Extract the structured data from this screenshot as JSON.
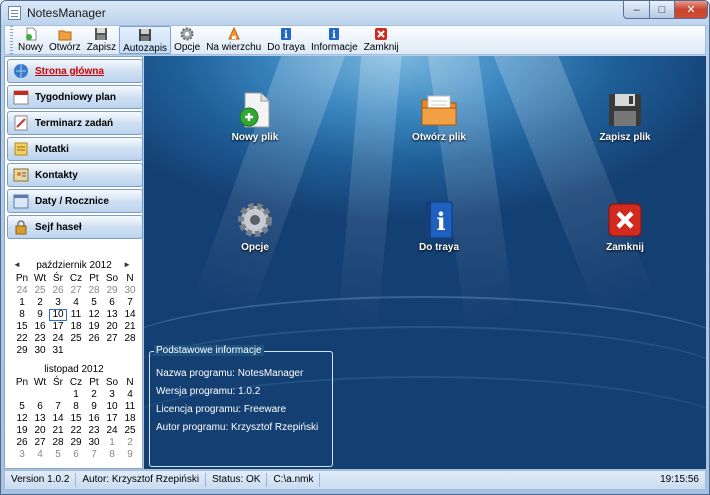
{
  "window": {
    "title": "NotesManager",
    "min_glyph": "–",
    "max_glyph": "□",
    "close_glyph": "✕"
  },
  "toolbar": {
    "items": [
      {
        "label": "Nowy",
        "icon": "new-file-icon"
      },
      {
        "label": "Otwórz",
        "icon": "open-folder-icon"
      },
      {
        "label": "Zapisz",
        "icon": "save-icon"
      },
      {
        "label": "Autozapis",
        "icon": "autosave-icon"
      },
      {
        "label": "Opcje",
        "icon": "gear-icon"
      },
      {
        "label": "Na wierzchu",
        "icon": "on-top-icon"
      },
      {
        "label": "Do traya",
        "icon": "info-icon"
      },
      {
        "label": "Informacje",
        "icon": "info-icon"
      },
      {
        "label": "Zamknij",
        "icon": "close-icon"
      }
    ]
  },
  "sidebar": {
    "items": [
      {
        "label": "Strona główna",
        "icon": "home-icon"
      },
      {
        "label": "Tygodniowy plan",
        "icon": "calendar-icon"
      },
      {
        "label": "Terminarz zadań",
        "icon": "notepad-icon"
      },
      {
        "label": "Notatki",
        "icon": "notes-icon"
      },
      {
        "label": "Kontakty",
        "icon": "contacts-icon"
      },
      {
        "label": "Daty / Rocznice",
        "icon": "dates-icon"
      },
      {
        "label": "Sejf haseł",
        "icon": "safe-icon"
      }
    ]
  },
  "calendar": {
    "prev": "◄",
    "next": "►",
    "day_headers": [
      "Pn",
      "Wt",
      "Śr",
      "Cz",
      "Pt",
      "So",
      "N"
    ],
    "month1": {
      "title": "październik 2012",
      "days": [
        [
          "24",
          "25",
          "26",
          "27",
          "28",
          "29",
          "30"
        ],
        [
          "1",
          "2",
          "3",
          "4",
          "5",
          "6",
          "7"
        ],
        [
          "8",
          "9",
          "10",
          "11",
          "12",
          "13",
          "14"
        ],
        [
          "15",
          "16",
          "17",
          "18",
          "19",
          "20",
          "21"
        ],
        [
          "22",
          "23",
          "24",
          "25",
          "26",
          "27",
          "28"
        ],
        [
          "29",
          "30",
          "31",
          "",
          "",
          "",
          ""
        ]
      ],
      "today": "10"
    },
    "month2": {
      "title": "listopad 2012",
      "days": [
        [
          "",
          "",
          "",
          "1",
          "2",
          "3",
          "4"
        ],
        [
          "5",
          "6",
          "7",
          "8",
          "9",
          "10",
          "11"
        ],
        [
          "12",
          "13",
          "14",
          "15",
          "16",
          "17",
          "18"
        ],
        [
          "19",
          "20",
          "21",
          "22",
          "23",
          "24",
          "25"
        ],
        [
          "26",
          "27",
          "28",
          "29",
          "30",
          "1",
          "2"
        ],
        [
          "3",
          "4",
          "5",
          "6",
          "7",
          "8",
          "9"
        ]
      ]
    }
  },
  "desktop": {
    "icons": [
      {
        "label": "Nowy plik",
        "icon": "new-file-icon"
      },
      {
        "label": "Otwórz plik",
        "icon": "open-folder-icon"
      },
      {
        "label": "Zapisz plik",
        "icon": "save-icon"
      },
      {
        "label": "Opcje",
        "icon": "gear-icon"
      },
      {
        "label": "Do traya",
        "icon": "info-icon"
      },
      {
        "label": "Zamknij",
        "icon": "close-icon"
      }
    ]
  },
  "info": {
    "title": "Podstawowe informacje",
    "rows": [
      "Nazwa programu: NotesManager",
      "Wersja programu: 1.0.2",
      "Licencja programu: Freeware",
      "Autor programu: Krzysztof Rzepiński"
    ]
  },
  "status": {
    "version": "Version 1.0.2",
    "author": "Autor: Krzysztof Rzepiński",
    "state": "Status: OK",
    "path": "C:\\a.nmk",
    "time": "19:15:56"
  },
  "colors": {
    "accent": "#1f5f98",
    "selected_nav": "#d00000"
  }
}
